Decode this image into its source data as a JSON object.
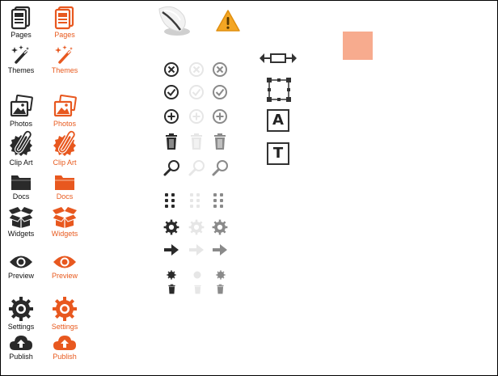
{
  "colors": {
    "dark": "#2a2a2a",
    "orange": "#e8581f",
    "faded": "#e6e6e6",
    "gray": "#8a8a8a",
    "warning": "#f4a623",
    "swatch": "#f7ab8e"
  },
  "sidebar": {
    "dark": {
      "pages": "Pages",
      "themes": "Themes",
      "photos": "Photos",
      "clipart": "Clip Art",
      "docs": "Docs",
      "widgets": "Widgets",
      "preview": "Preview",
      "settings": "Settings",
      "publish": "Publish"
    },
    "orange": {
      "pages": "Pages",
      "themes": "Themes",
      "photos": "Photos",
      "clipart": "Clip Art",
      "docs": "Docs",
      "widgets": "Widgets",
      "preview": "Preview",
      "settings": "Settings",
      "publish": "Publish"
    }
  },
  "icon_grid": {
    "states": [
      "normal",
      "disabled",
      "hover"
    ],
    "rows": [
      "close-icon",
      "check-icon",
      "plus-icon",
      "trash-icon",
      "zoom-icon",
      "grid-icon",
      "gear-icon",
      "arrow-right-icon",
      "small-gear-icon",
      "small-trash-icon"
    ]
  },
  "tools": {
    "text_box_letter": "A",
    "title_box_letter": "T"
  }
}
